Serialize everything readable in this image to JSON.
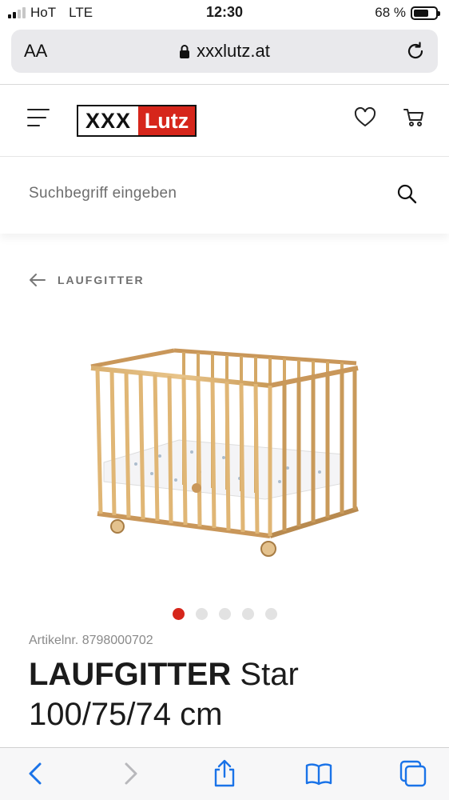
{
  "status": {
    "carrier": "HoT",
    "network": "LTE",
    "time": "12:30",
    "battery": "68 %",
    "battery_level": 0.68
  },
  "browser": {
    "text_size": "AA",
    "url": "xxxlutz.at"
  },
  "header": {
    "logo_left": "XXX",
    "logo_right": "Lutz"
  },
  "search": {
    "placeholder": "Suchbegriff eingeben"
  },
  "breadcrumb": {
    "label": "LAUFGITTER"
  },
  "product": {
    "article_nr": "Artikelnr. 8798000702",
    "title_bold": "LAUFGITTER",
    "title_rest": " Star",
    "dimensions": "100/75/74 cm",
    "image_count": 5,
    "active_image": 1
  },
  "colors": {
    "brand_red": "#d6261b",
    "ios_blue": "#1a73e8"
  }
}
